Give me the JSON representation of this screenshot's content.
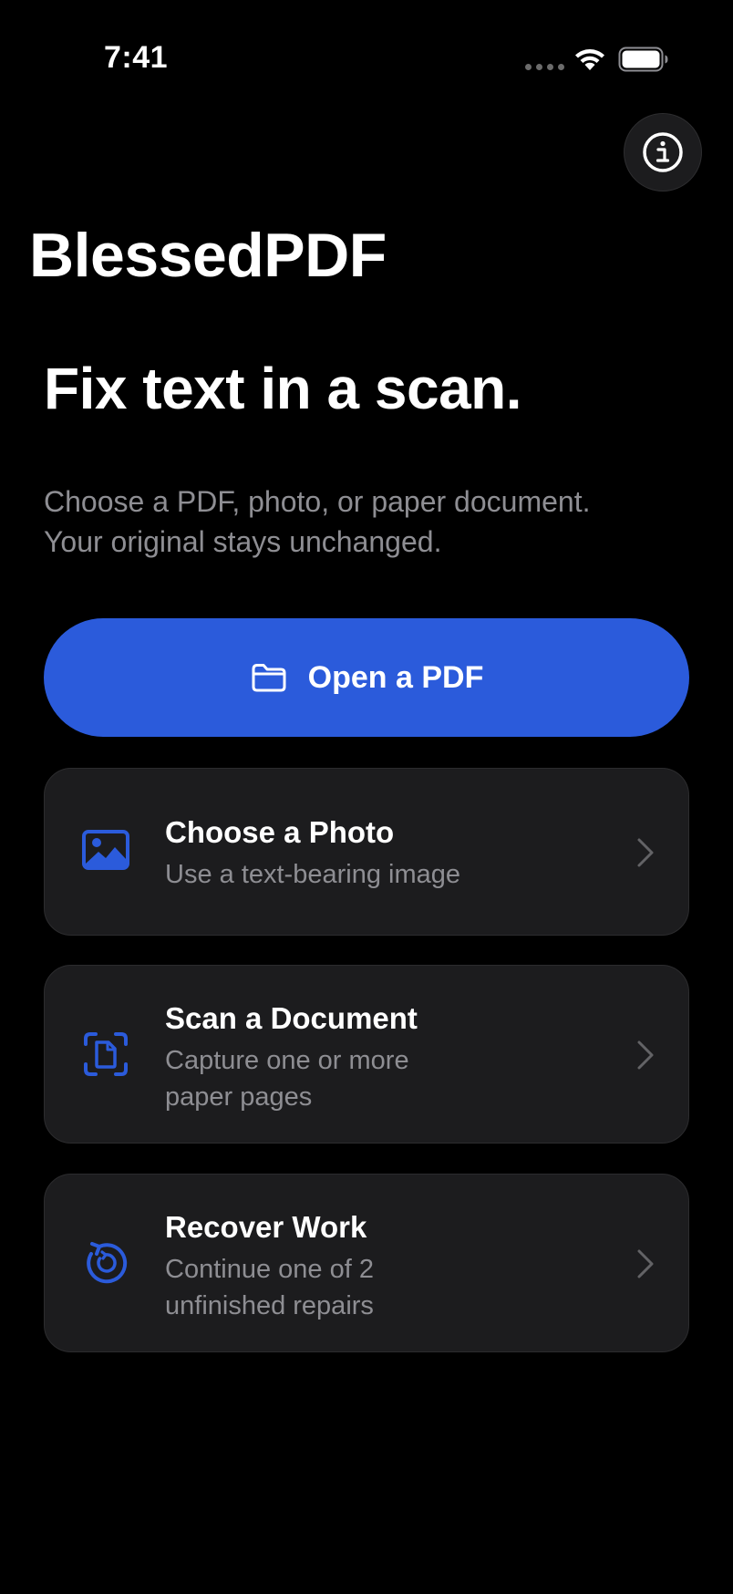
{
  "status_bar": {
    "time": "7:41"
  },
  "header": {
    "app_title": "BlessedPDF",
    "info_icon": "info-circle-icon"
  },
  "hero": {
    "headline": "Fix text in a scan.",
    "subtext_lines": [
      "Choose a PDF, photo, or paper document.",
      "Your original stays unchanged."
    ]
  },
  "primary_action": {
    "icon": "folder-icon",
    "label": "Open a PDF"
  },
  "options": [
    {
      "icon": "photo-icon",
      "title": "Choose a Photo",
      "desc_lines": [
        "Use a text-bearing image"
      ]
    },
    {
      "icon": "document-scan-icon",
      "title": "Scan a Document",
      "desc_lines": [
        "Capture one or more",
        "paper pages"
      ]
    },
    {
      "icon": "recover-icon",
      "title": "Recover Work",
      "desc_lines": [
        "Continue one of 2",
        "unfinished repairs"
      ]
    }
  ],
  "colors": {
    "background": "#000000",
    "accent": "#2b5bdb",
    "card": "#1c1c1e",
    "secondary_text": "#8e8e93"
  }
}
